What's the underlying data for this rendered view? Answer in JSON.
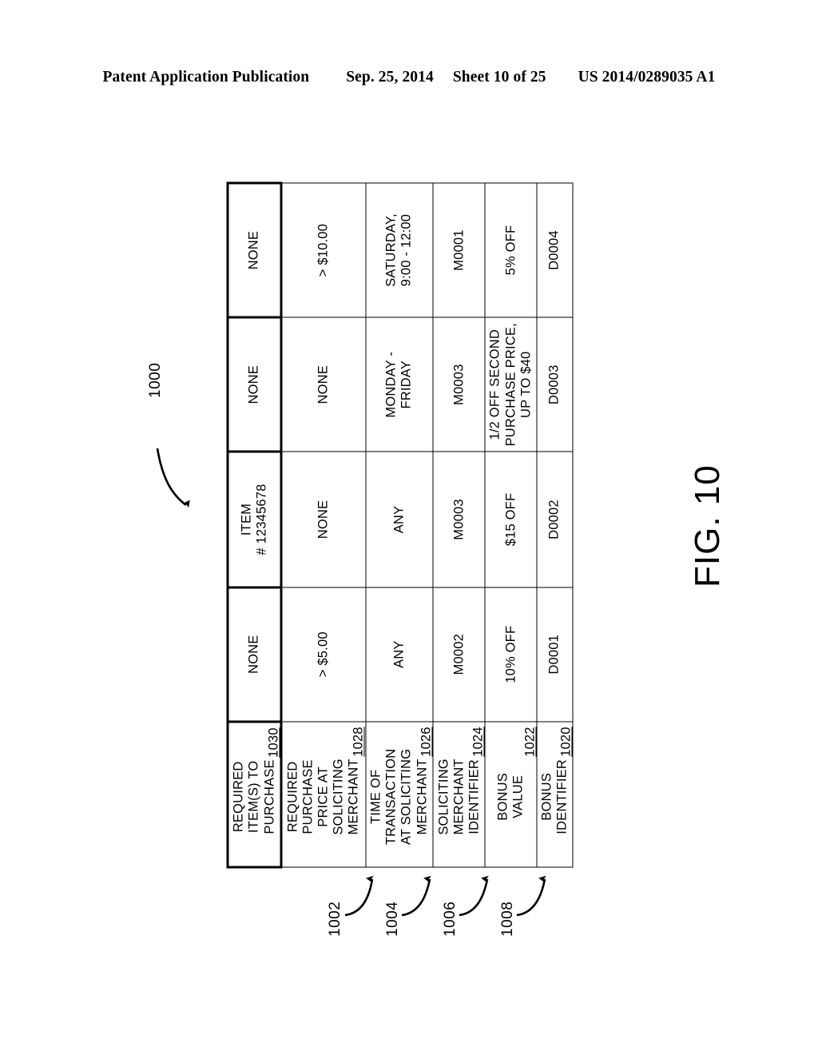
{
  "publication_header": {
    "left": "Patent Application Publication",
    "date": "Sep. 25, 2014",
    "sheet": "Sheet 10 of 25",
    "pub_number": "US 2014/0289035 A1"
  },
  "figure": {
    "caption": "FIG. 10",
    "table_reference": "1000",
    "row_callouts": [
      "1002",
      "1004",
      "1006",
      "1008"
    ]
  },
  "table": {
    "headers": [
      {
        "label": "BONUS\nIDENTIFIER",
        "ref": "1020"
      },
      {
        "label": "BONUS\nVALUE",
        "ref": "1022"
      },
      {
        "label": "SOLICITING\nMERCHANT\nIDENTIFIER",
        "ref": "1024"
      },
      {
        "label": "TIME OF\nTRANSACTION\nAT SOLICITING\nMERCHANT",
        "ref": "1026"
      },
      {
        "label": "REQUIRED\nPURCHASE\nPRICE AT\nSOLICITING\nMERCHANT",
        "ref": "1028"
      },
      {
        "label": "REQUIRED\nITEM(S) TO\nPURCHASE",
        "ref": "1030"
      }
    ],
    "rows": [
      {
        "callout": "1002",
        "bonus_identifier": "D0001",
        "bonus_value": "10% OFF",
        "soliciting_merchant_identifier": "M0002",
        "time_of_transaction": "ANY",
        "required_purchase_price": "> $5.00",
        "required_items": "NONE"
      },
      {
        "callout": "1004",
        "bonus_identifier": "D0002",
        "bonus_value": "$15 OFF",
        "soliciting_merchant_identifier": "M0003",
        "time_of_transaction": "ANY",
        "required_purchase_price": "NONE",
        "required_items": "ITEM\n# 12345678"
      },
      {
        "callout": "1006",
        "bonus_identifier": "D0003",
        "bonus_value": "1/2 OFF SECOND\nPURCHASE PRICE,\nUP TO $40",
        "soliciting_merchant_identifier": "M0003",
        "time_of_transaction": "MONDAY -\nFRIDAY",
        "required_purchase_price": "NONE",
        "required_items": "NONE"
      },
      {
        "callout": "1008",
        "bonus_identifier": "D0004",
        "bonus_value": "5% OFF",
        "soliciting_merchant_identifier": "M0001",
        "time_of_transaction": "SATURDAY,\n9:00 - 12:00",
        "required_purchase_price": "> $10.00",
        "required_items": "NONE"
      }
    ]
  },
  "colors": {
    "ink": "#000000",
    "paper": "#ffffff"
  }
}
